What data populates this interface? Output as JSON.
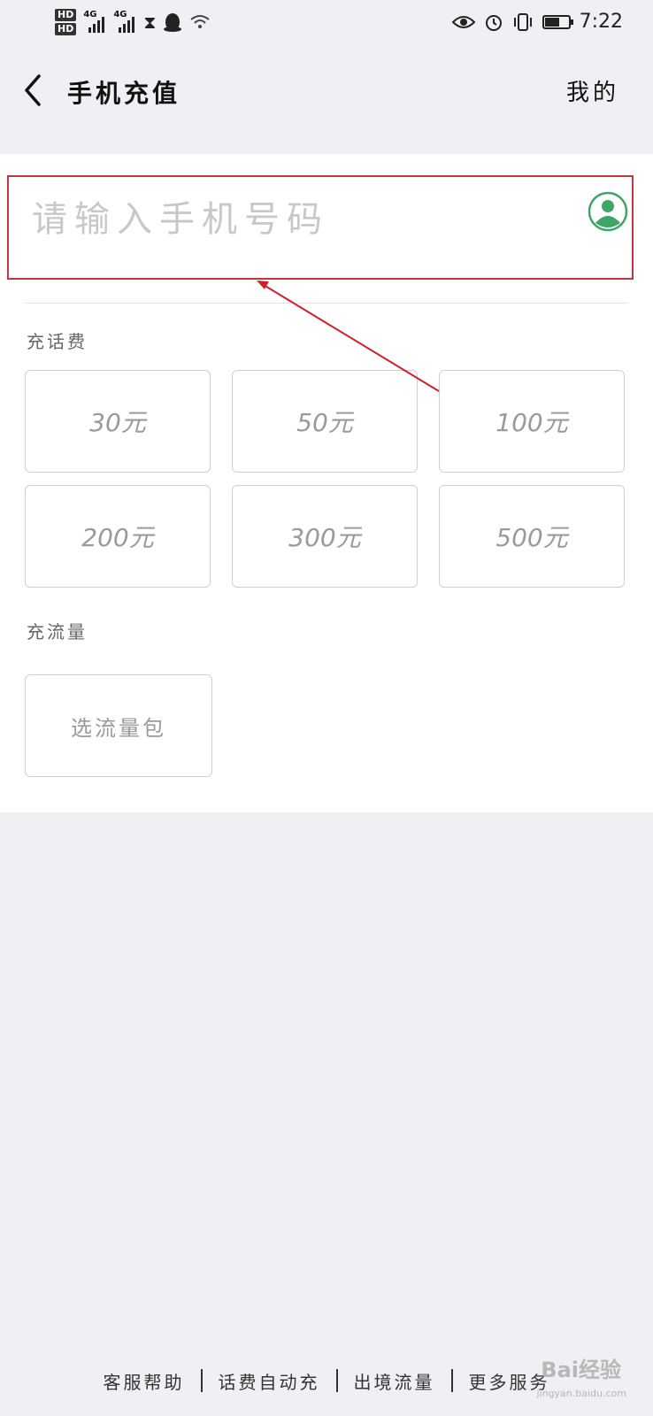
{
  "status_bar": {
    "hd1": "HD",
    "hd2": "HD",
    "net1": "4G",
    "net2": "4G",
    "battery_level": 0.6,
    "time": "7:22"
  },
  "nav": {
    "title": "手机充值",
    "mine": "我的"
  },
  "phone": {
    "placeholder": "请输入手机号码"
  },
  "call_section": {
    "label": "充话费",
    "amounts": [
      "30元",
      "50元",
      "100元",
      "200元",
      "300元",
      "500元"
    ]
  },
  "data_section": {
    "label": "充流量",
    "button": "选流量包"
  },
  "footer": {
    "links": [
      "客服帮助",
      "话费自动充",
      "出境流量",
      "更多服务"
    ]
  },
  "watermark": {
    "brand": "Bai经验",
    "url": "jingyan.baidu.com"
  },
  "colors": {
    "annotation": "#d0212b",
    "contact_green": "#3fa66a"
  }
}
